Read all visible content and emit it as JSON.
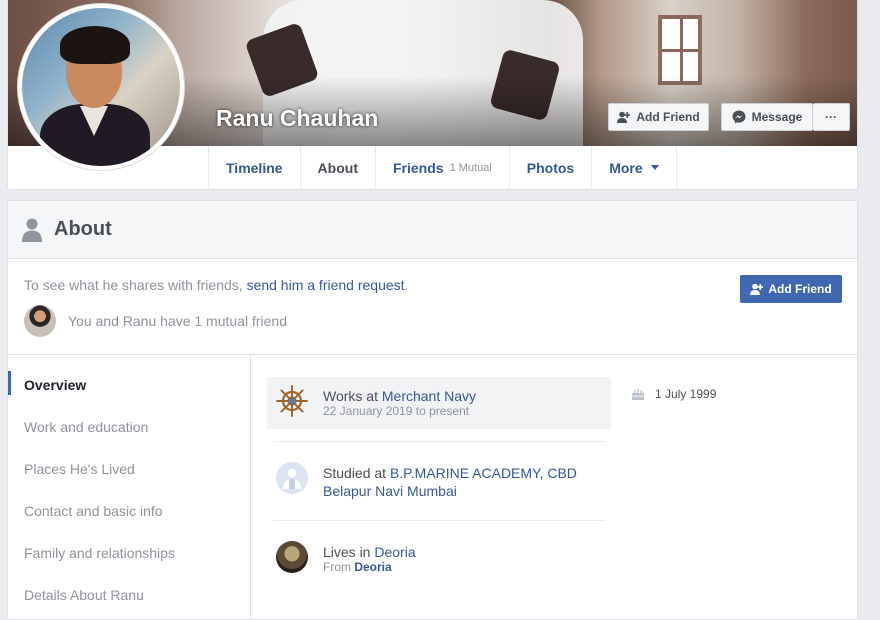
{
  "profile": {
    "name": "Ranu Chauhan",
    "add_friend": "Add Friend",
    "message": "Message",
    "more_dots": "···"
  },
  "tabs": [
    {
      "label": "Timeline"
    },
    {
      "label": "About"
    },
    {
      "label": "Friends",
      "sub": "1 Mutual"
    },
    {
      "label": "Photos"
    },
    {
      "label": "More"
    }
  ],
  "about": {
    "title": "About",
    "notice_prefix": "To see what he shares with friends, ",
    "notice_link": "send him a friend request",
    "notice_suffix": ".",
    "add_friend": "Add Friend",
    "mutual_text": "You and Ranu have 1 mutual friend"
  },
  "nav": [
    {
      "label": "Overview"
    },
    {
      "label": "Work and education"
    },
    {
      "label": "Places He's Lived"
    },
    {
      "label": "Contact and basic info"
    },
    {
      "label": "Family and relationships"
    },
    {
      "label": "Details About Ranu"
    }
  ],
  "overview": {
    "work_prefix": "Works at ",
    "work_place": "Merchant Navy",
    "work_dates": "22 January 2019 to present",
    "study_prefix": "Studied at ",
    "study_place": "B.P.MARINE ACADEMY, CBD Belapur Navi Mumbai",
    "lives_prefix": "Lives in ",
    "lives_place": "Deoria",
    "from_prefix": "From ",
    "from_place": "Deoria",
    "birthday": "1 July 1999"
  },
  "colors": {
    "link": "#365899",
    "primary_button": "#4267b2",
    "muted_text": "#90949c",
    "page_bg": "#e9ebee"
  }
}
